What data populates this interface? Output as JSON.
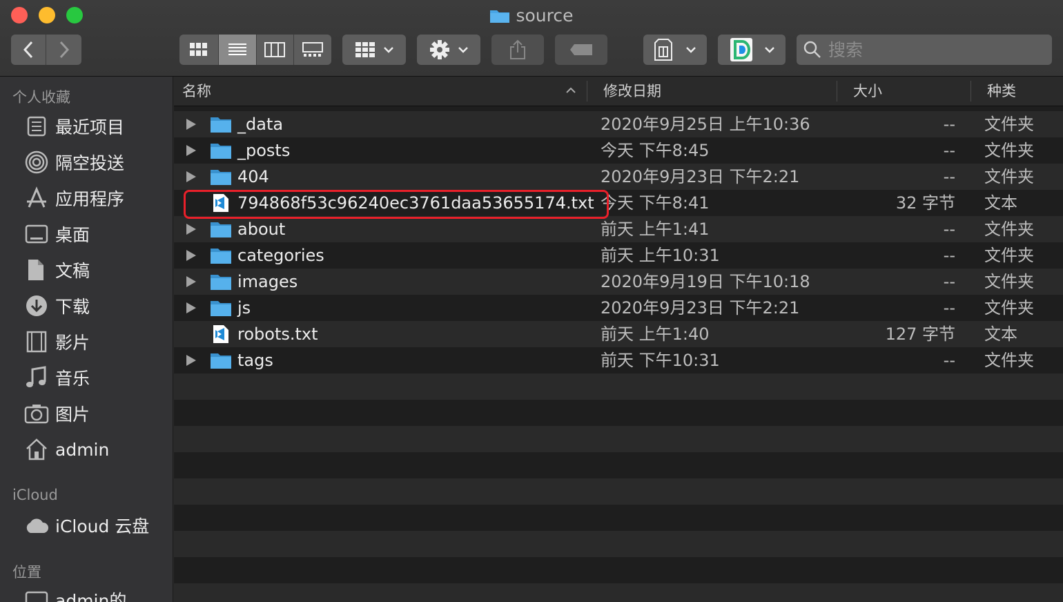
{
  "window": {
    "title": "source"
  },
  "toolbar": {
    "search_placeholder": "搜索"
  },
  "sidebar": {
    "favorites_header": "个人收藏",
    "favorites": [
      {
        "label": "最近项目",
        "icon": "recents-icon"
      },
      {
        "label": "隔空投送",
        "icon": "airdrop-icon"
      },
      {
        "label": "应用程序",
        "icon": "applications-icon"
      },
      {
        "label": "桌面",
        "icon": "desktop-icon"
      },
      {
        "label": "文稿",
        "icon": "documents-icon"
      },
      {
        "label": "下载",
        "icon": "downloads-icon"
      },
      {
        "label": "影片",
        "icon": "movies-icon"
      },
      {
        "label": "音乐",
        "icon": "music-icon"
      },
      {
        "label": "图片",
        "icon": "pictures-icon"
      },
      {
        "label": "admin",
        "icon": "home-icon"
      }
    ],
    "icloud_header": "iCloud",
    "icloud_items": [
      {
        "label": "iCloud 云盘",
        "icon": "cloud-icon"
      }
    ],
    "locations_header": "位置",
    "locations_items": [
      {
        "label": "admin的",
        "icon": "computer-icon"
      }
    ]
  },
  "columns": {
    "name": "名称",
    "date": "修改日期",
    "size": "大小",
    "kind": "种类"
  },
  "files": [
    {
      "name": "_data",
      "date": "2020年9月25日 上午10:36",
      "size": "--",
      "kind": "文件夹",
      "type": "folder"
    },
    {
      "name": "_posts",
      "date": "今天 下午8:45",
      "size": "--",
      "kind": "文件夹",
      "type": "folder"
    },
    {
      "name": "404",
      "date": "2020年9月23日 下午2:21",
      "size": "--",
      "kind": "文件夹",
      "type": "folder"
    },
    {
      "name": "794868f53c96240ec3761daa53655174.txt",
      "date": "今天 下午8:41",
      "size": "32 字节",
      "kind": "文本",
      "type": "file"
    },
    {
      "name": "about",
      "date": "前天 上午1:41",
      "size": "--",
      "kind": "文件夹",
      "type": "folder"
    },
    {
      "name": "categories",
      "date": "前天 上午10:31",
      "size": "--",
      "kind": "文件夹",
      "type": "folder"
    },
    {
      "name": "images",
      "date": "2020年9月19日 下午10:18",
      "size": "--",
      "kind": "文件夹",
      "type": "folder"
    },
    {
      "name": "js",
      "date": "2020年9月23日 下午2:21",
      "size": "--",
      "kind": "文件夹",
      "type": "folder"
    },
    {
      "name": "robots.txt",
      "date": "前天 上午1:40",
      "size": "127 字节",
      "kind": "文本",
      "type": "file"
    },
    {
      "name": "tags",
      "date": "前天 下午10:31",
      "size": "--",
      "kind": "文件夹",
      "type": "folder"
    }
  ],
  "colors": {
    "highlight": "#e8202a",
    "folder": "#48a6e6"
  }
}
